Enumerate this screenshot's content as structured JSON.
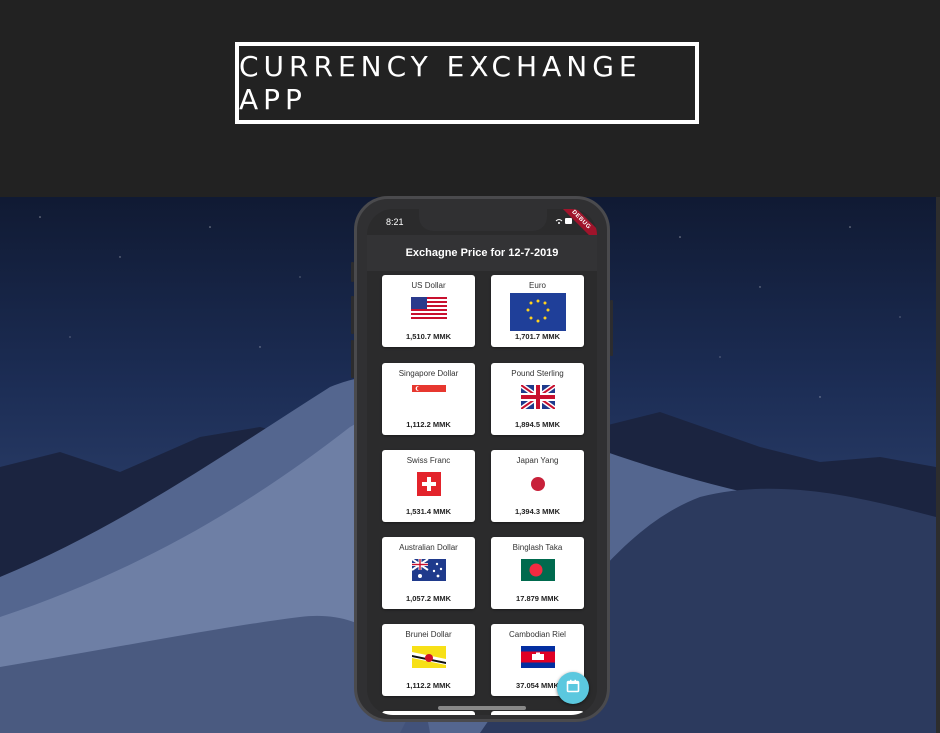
{
  "banner": {
    "title": "CURRENCY EXCHANGE APP"
  },
  "phone": {
    "status_time": "8:21",
    "debug_label": "DEBUG",
    "appbar_title": "Exchagne Price for 12-7-2019"
  },
  "currencies": [
    {
      "name": "US Dollar",
      "price": "1,510.7 MMK",
      "flag": "us-flag-icon"
    },
    {
      "name": "Euro",
      "price": "1,701.7 MMK",
      "flag": "eu-flag-icon"
    },
    {
      "name": "Singapore Dollar",
      "price": "1,112.2 MMK",
      "flag": "sg-flag-icon"
    },
    {
      "name": "Pound Sterling",
      "price": "1,894.5 MMK",
      "flag": "uk-flag-icon"
    },
    {
      "name": "Swiss Franc",
      "price": "1,531.4 MMK",
      "flag": "ch-flag-icon"
    },
    {
      "name": "Japan Yang",
      "price": "1,394.3 MMK",
      "flag": "jp-flag-icon"
    },
    {
      "name": "Australian Dollar",
      "price": "1,057.2 MMK",
      "flag": "au-flag-icon"
    },
    {
      "name": "Binglash Taka",
      "price": "17.879 MMK",
      "flag": "bd-flag-icon"
    },
    {
      "name": "Brunei Dollar",
      "price": "1,112.2 MMK",
      "flag": "bn-flag-icon"
    },
    {
      "name": "Cambodian Riel",
      "price": "37.054 MMK",
      "flag": "kh-flag-icon"
    }
  ],
  "fab": {
    "icon": "calendar-icon",
    "color": "#5bc8df"
  }
}
